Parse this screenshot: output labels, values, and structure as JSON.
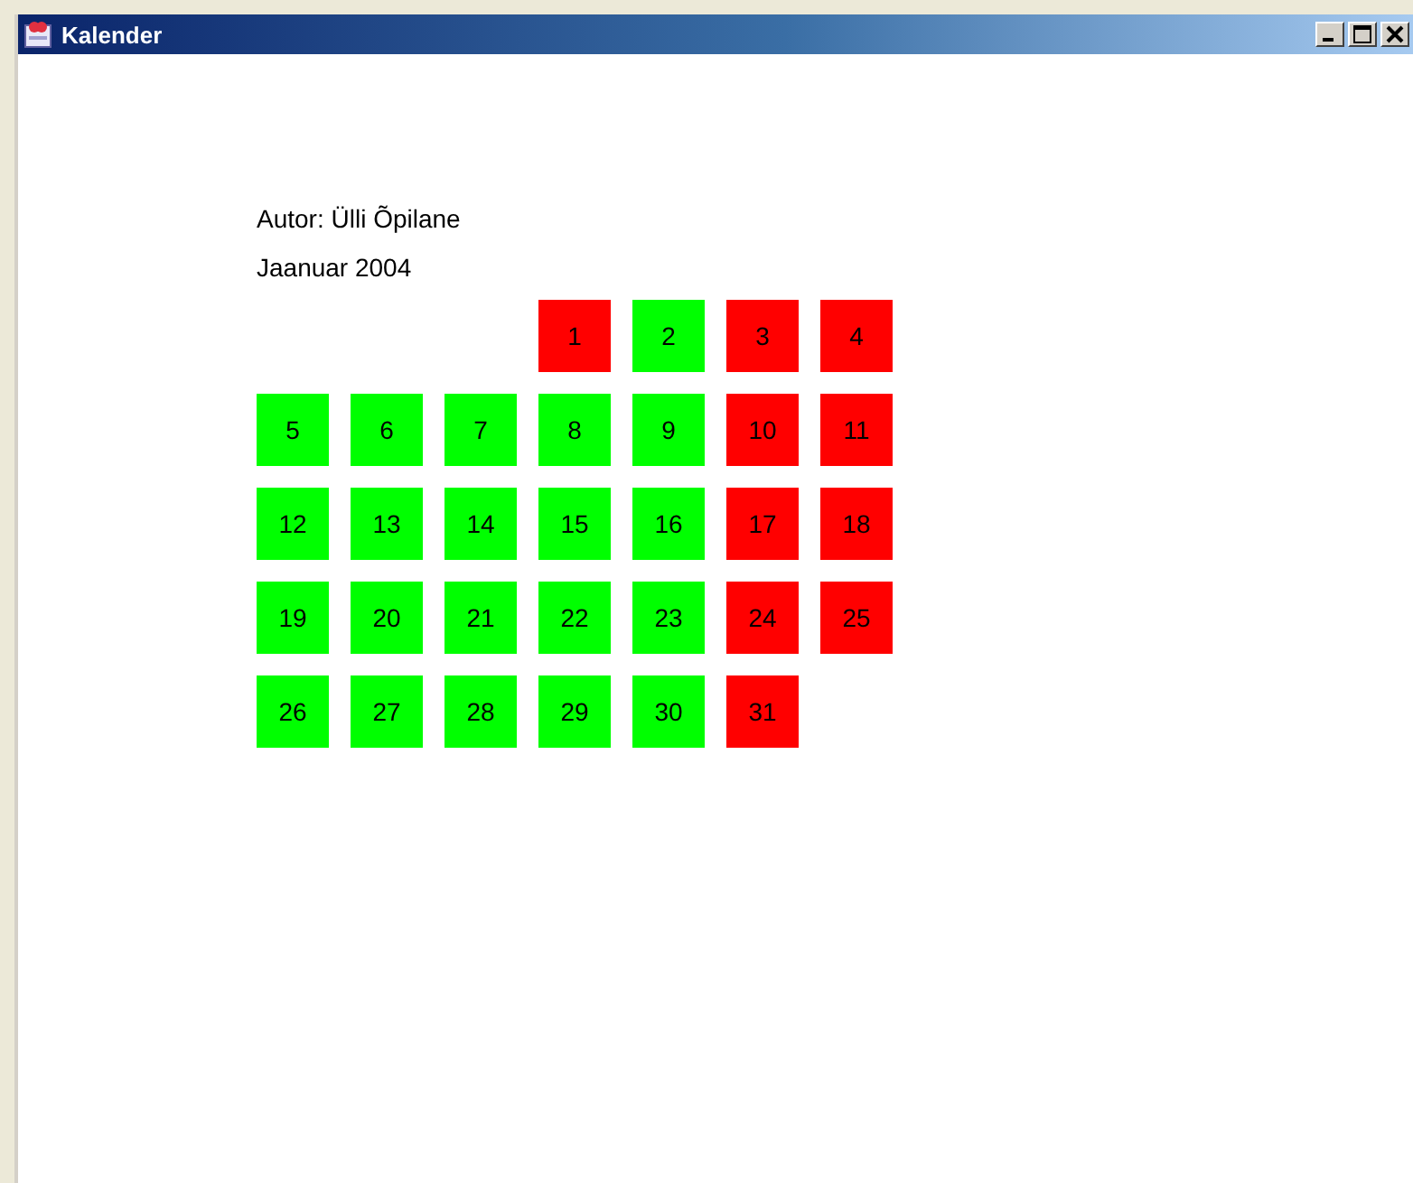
{
  "window": {
    "title": "Kalender"
  },
  "author": "Autor: Ülli Õpilane",
  "month": "Jaanuar 2004",
  "weeks": [
    [
      {
        "day": "1",
        "color": "#ff0000"
      },
      {
        "day": "2",
        "color": "#00ff00"
      },
      {
        "day": "3",
        "color": "#ff0000"
      },
      {
        "day": "4",
        "color": "#ff0000"
      }
    ],
    [
      {
        "day": "5",
        "color": "#00ff00"
      },
      {
        "day": "6",
        "color": "#00ff00"
      },
      {
        "day": "7",
        "color": "#00ff00"
      },
      {
        "day": "8",
        "color": "#00ff00"
      },
      {
        "day": "9",
        "color": "#00ff00"
      },
      {
        "day": "10",
        "color": "#ff0000"
      },
      {
        "day": "11",
        "color": "#ff0000"
      }
    ],
    [
      {
        "day": "12",
        "color": "#00ff00"
      },
      {
        "day": "13",
        "color": "#00ff00"
      },
      {
        "day": "14",
        "color": "#00ff00"
      },
      {
        "day": "15",
        "color": "#00ff00"
      },
      {
        "day": "16",
        "color": "#00ff00"
      },
      {
        "day": "17",
        "color": "#ff0000"
      },
      {
        "day": "18",
        "color": "#ff0000"
      }
    ],
    [
      {
        "day": "19",
        "color": "#00ff00"
      },
      {
        "day": "20",
        "color": "#00ff00"
      },
      {
        "day": "21",
        "color": "#00ff00"
      },
      {
        "day": "22",
        "color": "#00ff00"
      },
      {
        "day": "23",
        "color": "#00ff00"
      },
      {
        "day": "24",
        "color": "#ff0000"
      },
      {
        "day": "25",
        "color": "#ff0000"
      }
    ],
    [
      {
        "day": "26",
        "color": "#00ff00"
      },
      {
        "day": "27",
        "color": "#00ff00"
      },
      {
        "day": "28",
        "color": "#00ff00"
      },
      {
        "day": "29",
        "color": "#00ff00"
      },
      {
        "day": "30",
        "color": "#00ff00"
      },
      {
        "day": "31",
        "color": "#ff0000"
      }
    ]
  ]
}
